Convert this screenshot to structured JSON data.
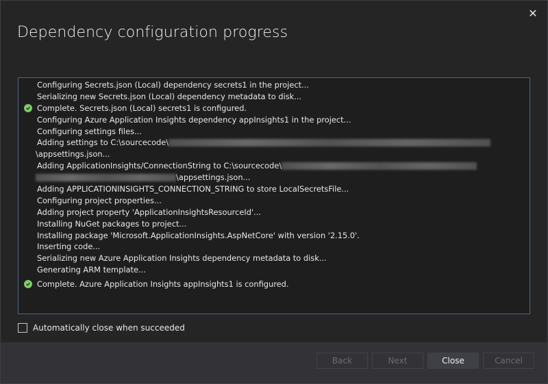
{
  "dialog": {
    "title": "Dependency configuration progress",
    "close_icon": "close-icon"
  },
  "log": {
    "lines": [
      "Configuring Secrets.json (Local) dependency secrets1 in the project...",
      "Serializing new Secrets.json (Local) dependency metadata to disk...",
      "Complete. Secrets.json (Local) secrets1 is configured.",
      "Configuring Azure Application Insights dependency appInsights1 in the project...",
      "Configuring settings files...",
      "Adding settings to C:\\sourcecode\\",
      "\\appsettings.json...",
      "Adding ApplicationInsights/ConnectionString to C:\\sourcecode\\",
      "\\appsettings.json...",
      "Adding APPLICATIONINSIGHTS_CONNECTION_STRING to store LocalSecretsFile...",
      "Configuring project properties...",
      "Adding project property 'ApplicationInsightsResourceId'...",
      "Installing NuGet packages to project...",
      "Installing package 'Microsoft.ApplicationInsights.AspNetCore' with version '2.15.0'.",
      "Inserting code...",
      "Serializing new Azure Application Insights dependency metadata to disk...",
      "Generating ARM template...",
      "Complete. Azure Application Insights appInsights1 is configured."
    ]
  },
  "auto_close": {
    "label": "Automatically close when succeeded",
    "checked": false
  },
  "footer": {
    "back_label": "Back",
    "next_label": "Next",
    "close_label": "Close",
    "cancel_label": "Cancel"
  }
}
